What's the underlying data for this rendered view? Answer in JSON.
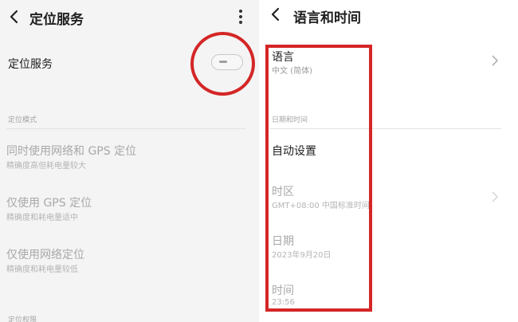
{
  "left_screen": {
    "title": "定位服务",
    "main_toggle": {
      "label": "定位服务",
      "state": "off"
    },
    "section_mode": "定位模式",
    "modes": [
      {
        "title": "同时使用网络和 GPS 定位",
        "subtitle": "精确度高但耗电量较大"
      },
      {
        "title": "仅使用 GPS 定位",
        "subtitle": "精确度和耗电量适中"
      },
      {
        "title": "仅使用网络定位",
        "subtitle": "精确度和耗电量较低"
      }
    ],
    "section_permission": "定位权限"
  },
  "right_screen": {
    "title": "语言和时间",
    "language": {
      "title": "语言",
      "value": "中文 (简体)"
    },
    "section_datetime": "日期和时间",
    "auto_setting": {
      "label": "自动设置",
      "state": "on"
    },
    "timezone": {
      "title": "时区",
      "value": "GMT+08:00 中国标准时间"
    },
    "date": {
      "title": "日期",
      "value": "2023年9月20日"
    },
    "time": {
      "title": "时间",
      "value": "23:56"
    }
  },
  "colors": {
    "annotation": "#d42626",
    "toggle_on": "#1a73e8",
    "left_background": "#f4f4f4"
  }
}
